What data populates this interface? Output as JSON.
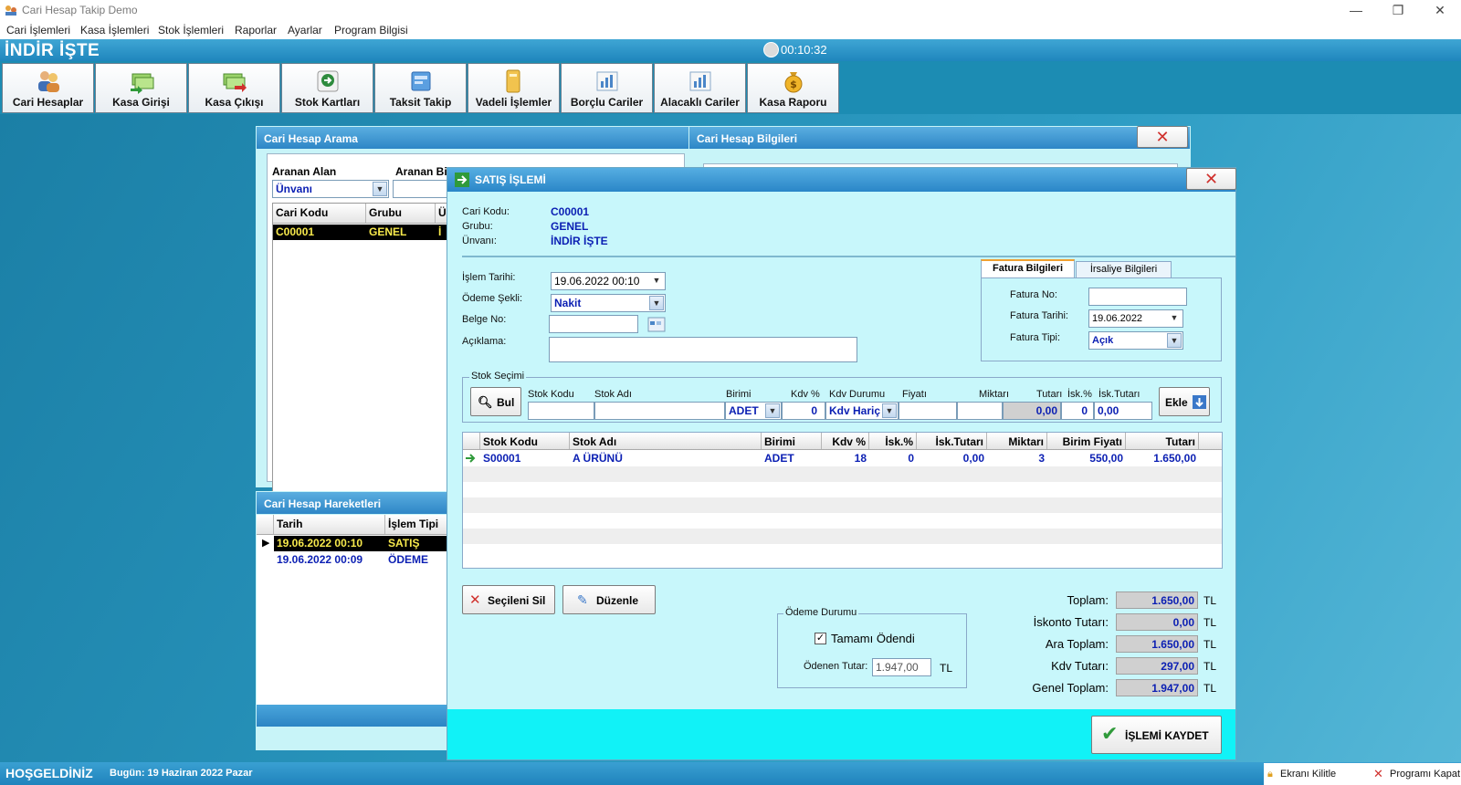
{
  "window": {
    "title": "Cari Hesap Takip Demo",
    "minimize": "—",
    "maximize": "❐",
    "close": "✕"
  },
  "menu": [
    "Cari İşlemleri",
    "Kasa İşlemleri",
    "Stok İşlemleri",
    "Raporlar",
    "Ayarlar",
    "Program Bilgisi"
  ],
  "header": {
    "company": "İNDİR İŞTE",
    "clock": "00:10:32"
  },
  "toolbar": [
    "Cari Hesaplar",
    "Kasa Girişi",
    "Kasa Çıkışı",
    "Stok Kartları",
    "Taksit Takip",
    "Vadeli İşlemler",
    "Borçlu Cariler",
    "Alacaklı Cariler",
    "Kasa Raporu"
  ],
  "search_panel": {
    "title": "Cari Hesap Arama",
    "field_label": "Aranan Alan",
    "info_label": "Aranan Bilgi",
    "field_value": "Ünvanı",
    "columns": [
      "Cari Kodu",
      "Grubu",
      "Ü"
    ],
    "rows": [
      [
        "C00001",
        "GENEL",
        "İ"
      ]
    ]
  },
  "info_panel": {
    "title": "Cari Hesap Bilgileri"
  },
  "moves_panel": {
    "title": "Cari Hesap Hareketleri",
    "columns": [
      "Tarih",
      "İşlem Tipi"
    ],
    "rows": [
      [
        "19.06.2022 00:10",
        "SATIŞ"
      ],
      [
        "19.06.2022 00:09",
        "ÖDEME"
      ]
    ]
  },
  "sale": {
    "title": "SATIŞ İŞLEMİ",
    "cari_kodu_label": "Cari Kodu:",
    "cari_kodu": "C00001",
    "grubu_label": "Grubu:",
    "grubu": "GENEL",
    "unvan_label": "Ünvanı:",
    "unvan": "İNDİR İŞTE",
    "islem_tarihi_label": "İşlem Tarihi:",
    "islem_tarihi": "19.06.2022 00:10",
    "odeme_sekli_label": "Ödeme Şekli:",
    "odeme_sekli": "Nakit",
    "belge_no_label": "Belge No:",
    "belge_no": "",
    "aciklama_label": "Açıklama:",
    "aciklama": "",
    "tabs": [
      "Fatura Bilgileri",
      "İrsaliye Bilgileri"
    ],
    "fatura_no_label": "Fatura No:",
    "fatura_no": "",
    "fatura_tarihi_label": "Fatura Tarihi:",
    "fatura_tarihi": "19.06.2022",
    "fatura_tipi_label": "Fatura Tipi:",
    "fatura_tipi": "Açık",
    "stok_secimi": "Stok Seçimi",
    "bul": "Bul",
    "stock_labels": [
      "Stok Kodu",
      "Stok Adı",
      "Birimi",
      "Kdv %",
      "Kdv Durumu",
      "Fiyatı",
      "Miktarı",
      "Tutarı",
      "İsk.%",
      "İsk.Tutarı"
    ],
    "stock_values": {
      "stok_kodu": "",
      "stok_adi": "",
      "birimi": "ADET",
      "kdv": "0",
      "kdv_durumu": "Kdv Hariç",
      "fiyati": "",
      "miktari": "",
      "tutari": "0,00",
      "isk": "0",
      "isk_tutari": "0,00"
    },
    "ekle": "Ekle",
    "grid_columns": [
      "Stok Kodu",
      "Stok Adı",
      "Birimi",
      "Kdv %",
      "İsk.%",
      "İsk.Tutarı",
      "Miktarı",
      "Birim Fiyatı",
      "Tutarı"
    ],
    "grid_rows": [
      [
        "S00001",
        "A ÜRÜNÜ",
        "ADET",
        "18",
        "0",
        "0,00",
        "3",
        "550,00",
        "1.650,00"
      ]
    ],
    "secileni_sil": "Seçileni Sil",
    "duzenle": "Düzenle",
    "odeme_durumu": "Ödeme Durumu",
    "tamami_odendi": "Tamamı Ödendi",
    "odenen_tutar_label": "Ödenen Tutar:",
    "odenen_tutar": "1.947,00",
    "currency": "TL",
    "totals": [
      {
        "label": "Toplam:",
        "value": "1.650,00"
      },
      {
        "label": "İskonto Tutarı:",
        "value": "0,00"
      },
      {
        "label": "Ara Toplam:",
        "value": "1.650,00"
      },
      {
        "label": "Kdv Tutarı:",
        "value": "297,00"
      },
      {
        "label": "Genel Toplam:",
        "value": "1.947,00"
      }
    ],
    "kaydet": "İŞLEMİ KAYDET",
    "close": "✕"
  },
  "status": {
    "welcome": "HOŞGELDİNİZ",
    "today": "Bugün: 19 Haziran 2022 Pazar",
    "lock": "Ekranı Kilitle",
    "exit": "Programı Kapat"
  }
}
